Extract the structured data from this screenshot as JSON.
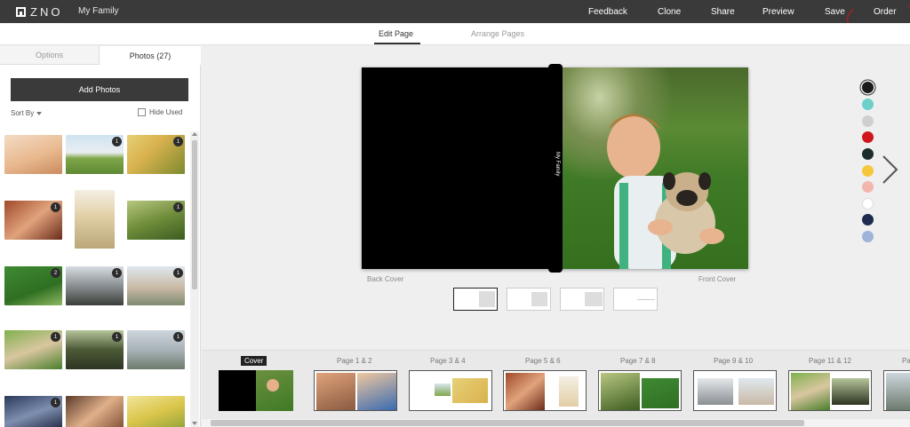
{
  "topbar": {
    "logo_text": "ZNO",
    "album_title": "My Family",
    "nav": [
      "Feedback",
      "Clone",
      "Share",
      "Preview",
      "Save",
      "Order"
    ]
  },
  "tabs": {
    "edit_page": "Edit Page",
    "arrange_pages": "Arrange Pages"
  },
  "left_panel": {
    "tab_options": "Options",
    "tab_photos": "Photos (27)",
    "add_photos": "Add Photos",
    "sort_by": "Sort By",
    "hide_used": "Hide Used",
    "photo_badges": [
      "",
      "1",
      "1",
      "1",
      "",
      "1",
      "2",
      "1",
      "1",
      "1",
      "1",
      "1",
      "1",
      "",
      ""
    ]
  },
  "canvas": {
    "spine_text": "My Family",
    "back_label": "Back Cover",
    "front_label": "Front Cover"
  },
  "swatch_colors": [
    "#1a1a1a",
    "#6ad0c8",
    "#cfcfcf",
    "#d0161d",
    "#1c2e2b",
    "#f5c73a",
    "#f2b6ad",
    "#ffffff",
    "#1e2a4f",
    "#9fb3da"
  ],
  "pages": [
    "Cover",
    "Page 1 & 2",
    "Page 3 & 4",
    "Page 5 & 6",
    "Page 7 & 8",
    "Page 9 & 10",
    "Page 11 & 12",
    "Pa"
  ],
  "accent": {
    "order_circle": "#dd1111"
  }
}
